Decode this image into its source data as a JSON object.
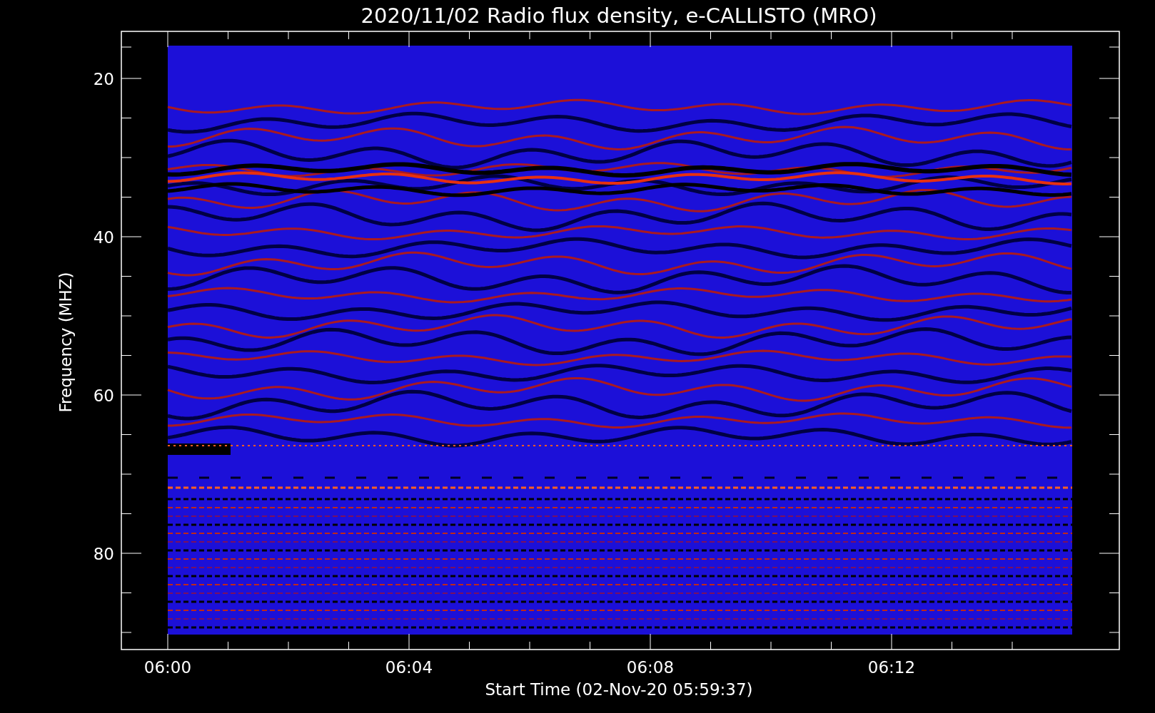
{
  "title": "2020/11/02  Radio flux density, e-CALLISTO (MRO)",
  "x_axis": {
    "label": "Start Time (02-Nov-20 05:59:37)",
    "ticks": [
      "06:00",
      "06:04",
      "06:08",
      "06:12"
    ]
  },
  "y_axis": {
    "label": "Frequency (MHZ)",
    "ticks": [
      "20",
      "40",
      "60",
      "80"
    ]
  }
}
